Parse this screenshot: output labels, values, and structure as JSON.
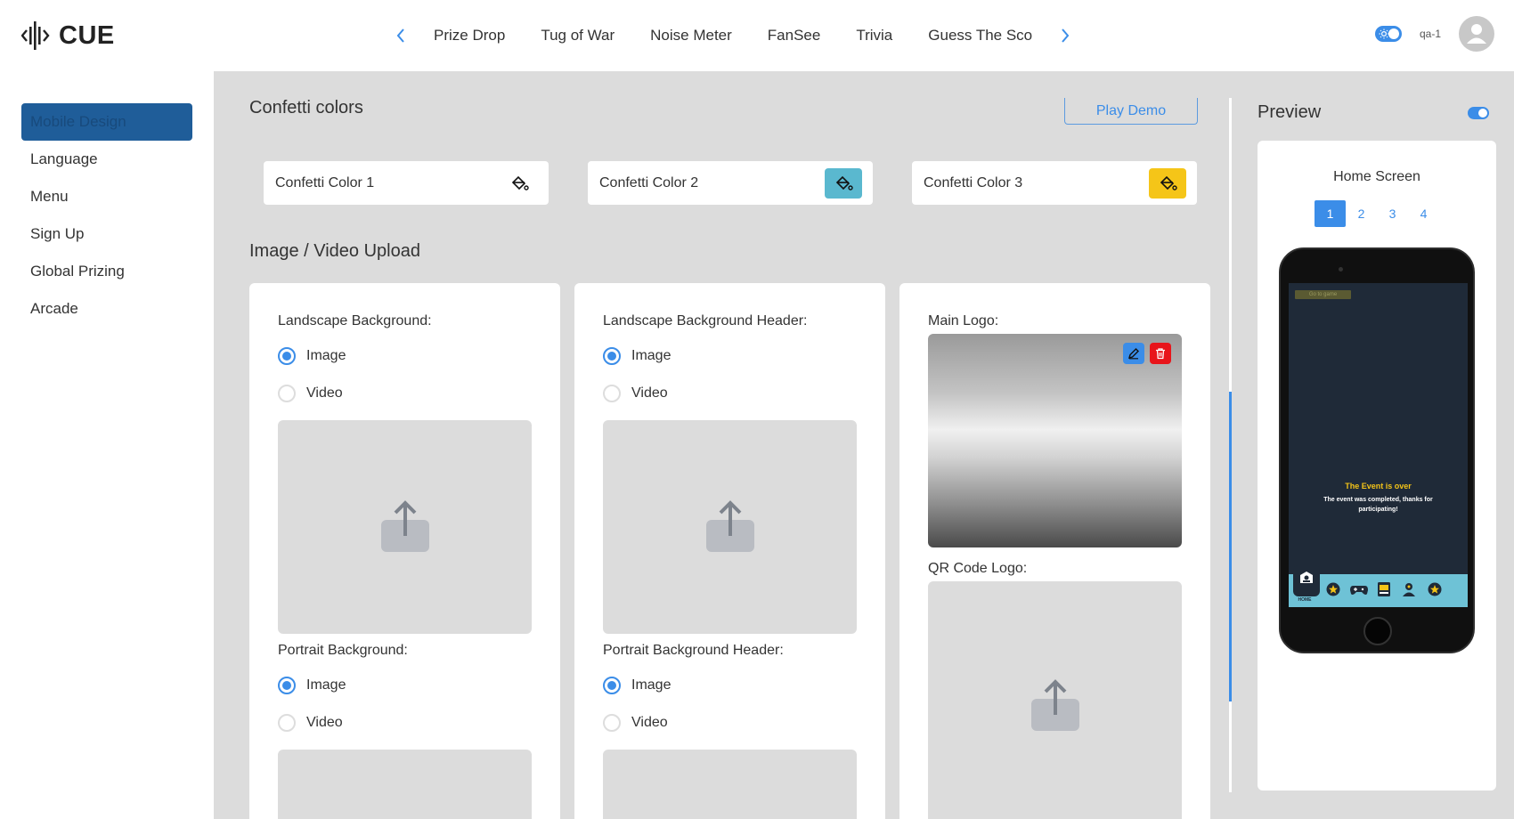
{
  "brand": {
    "name": "CUE"
  },
  "nav": {
    "prev_icon": "chevron-left-icon",
    "next_icon": "chevron-right-icon",
    "tabs": [
      "Prize Drop",
      "Tug of War",
      "Noise Meter",
      "FanSee",
      "Trivia",
      "Guess The Sco"
    ]
  },
  "header": {
    "user_name": "qa-1",
    "accent": "#3b8de8"
  },
  "sidebar": {
    "items": [
      {
        "label": "Mobile Design"
      },
      {
        "label": "Language"
      },
      {
        "label": "Menu"
      },
      {
        "label": "Sign Up"
      },
      {
        "label": "Global Prizing"
      },
      {
        "label": "Arcade"
      }
    ]
  },
  "confetti": {
    "title": "Confetti colors",
    "play_demo": "Play Demo",
    "colors": [
      {
        "label": "Confetti Color 1",
        "color": "#ffffff"
      },
      {
        "label": "Confetti Color 2",
        "color": "#5ab8cf"
      },
      {
        "label": "Confetti Color 3",
        "color": "#f5c518"
      }
    ]
  },
  "uploads": {
    "title": "Image / Video Upload",
    "option_image": "Image",
    "option_video": "Video",
    "cards": [
      {
        "label_top": "Landscape Background:",
        "label_bottom": "Portrait Background:"
      },
      {
        "label_top": "Landscape Background Header:",
        "label_bottom": "Portrait Background Header:"
      },
      {
        "label_top": "Main Logo:",
        "label_bottom": "QR Code Logo:"
      }
    ]
  },
  "preview": {
    "title": "Preview",
    "screen_name": "Home Screen",
    "pages": [
      "1",
      "2",
      "3",
      "4"
    ],
    "active_page": "1",
    "phone": {
      "button": "Go to game",
      "event_title": "The Event is over",
      "event_subtitle": "The event was completed, thanks for participating!",
      "home_label": "HOME"
    }
  }
}
